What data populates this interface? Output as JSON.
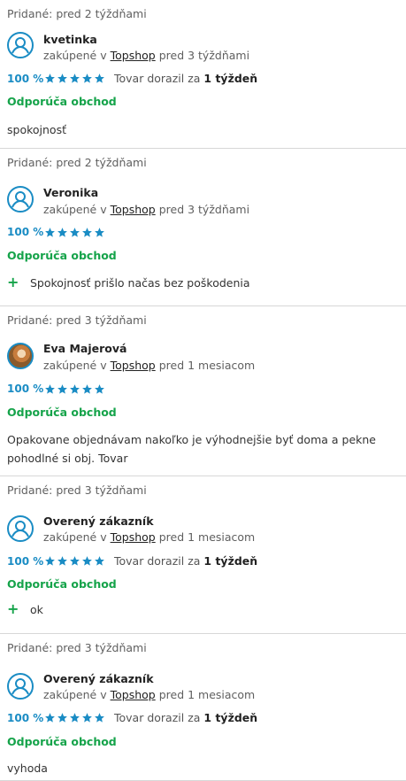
{
  "reviews": [
    {
      "added": "Pridané: pred 2 týždňami",
      "name": "kvetinka",
      "bought_prefix": "zakúpené v",
      "shop": "Topshop",
      "bought_suffix": "pred 3 týždňami",
      "percent": "100 %",
      "stars": 5,
      "delivery_prefix": "Tovar dorazil za",
      "delivery_value": "1 týždeň",
      "recommend": "Odporúča obchod",
      "comment": "spokojnosť",
      "comment_type": "plain",
      "avatar": "user-icon"
    },
    {
      "added": "Pridané: pred 2 týždňami",
      "name": "Veronika",
      "bought_prefix": "zakúpené v",
      "shop": "Topshop",
      "bought_suffix": "pred 3 týždňami",
      "percent": "100 %",
      "stars": 5,
      "delivery_prefix": "",
      "delivery_value": "",
      "recommend": "Odporúča obchod",
      "comment": "Spokojnosť prišlo načas bez poškodenia",
      "comment_type": "pro",
      "avatar": "user-icon"
    },
    {
      "added": "Pridané: pred 3 týždňami",
      "name": "Eva Majerová",
      "bought_prefix": "zakúpené v",
      "shop": "Topshop",
      "bought_suffix": "pred 1 mesiacom",
      "percent": "100 %",
      "stars": 5,
      "delivery_prefix": "",
      "delivery_value": "",
      "recommend": "Odporúča obchod",
      "comment": "Opakovane objednávam nakoľko je výhodnejšie byť doma a pekne pohodlné si obj. Tovar",
      "comment_type": "plain",
      "avatar": "photo"
    },
    {
      "added": "Pridané: pred 3 týždňami",
      "name": "Overený zákazník",
      "bought_prefix": "zakúpené v",
      "shop": "Topshop",
      "bought_suffix": "pred 1 mesiacom",
      "percent": "100 %",
      "stars": 5,
      "delivery_prefix": "Tovar dorazil za",
      "delivery_value": "1 týždeň",
      "recommend": "Odporúča obchod",
      "comment": "ok",
      "comment_type": "pro",
      "avatar": "user-icon"
    },
    {
      "added": "Pridané: pred 3 týždňami",
      "name": "Overený zákazník",
      "bought_prefix": "zakúpené v",
      "shop": "Topshop",
      "bought_suffix": "pred 1 mesiacom",
      "percent": "100 %",
      "stars": 5,
      "delivery_prefix": "Tovar dorazil za",
      "delivery_value": "1 týždeň",
      "recommend": "Odporúča obchod",
      "comment": "vyhoda",
      "comment_type": "plain",
      "avatar": "user-icon"
    }
  ],
  "colors": {
    "accent_blue": "#1a8cc4",
    "recommend_green": "#15a34a",
    "divider": "#d7d7d7"
  }
}
